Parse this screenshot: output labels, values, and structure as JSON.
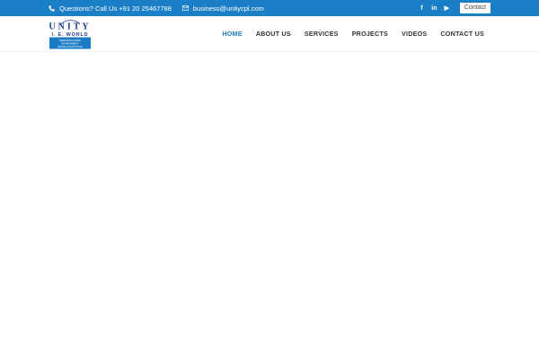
{
  "topbar": {
    "phone_text": "Questions? Call Us +91 20 25467788",
    "email_text": "business@unitycpl.com",
    "contact_label": "Contact",
    "social_icons": [
      "facebook-icon",
      "linkedin-icon",
      "youtube-icon"
    ],
    "social_glyphs": {
      "facebook": "f",
      "linkedin": "in",
      "youtube": "▶"
    },
    "background_color": "#1a7fc6"
  },
  "logo": {
    "brand_text": "UNITY",
    "subtitle": "I. E. WORLD",
    "tagline_lines": [
      "INFRASTRUCTURE",
      "ENVIRONMENT",
      "WATER & SANITATION"
    ],
    "brand_color": "#1b3f8f"
  },
  "nav": {
    "items": [
      {
        "label": "HOME",
        "active": true
      },
      {
        "label": "ABOUT US",
        "active": false
      },
      {
        "label": "SERVICES",
        "active": false
      },
      {
        "label": "PROJECTS",
        "active": false
      },
      {
        "label": "VIDEOS",
        "active": false
      },
      {
        "label": "CONTACT US",
        "active": false
      }
    ],
    "active_color": "#1a7fc6"
  }
}
